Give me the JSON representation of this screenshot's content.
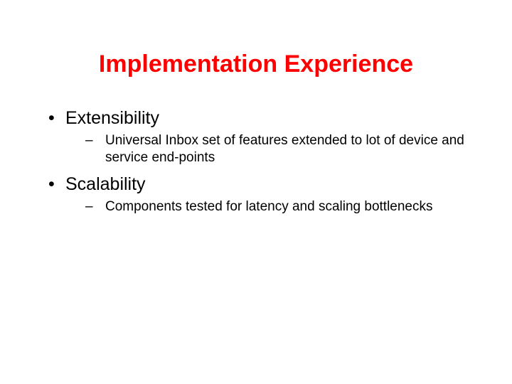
{
  "title": "Implementation Experience",
  "bullets": [
    {
      "text": "Extensibility",
      "sub": [
        "Universal Inbox set of features extended to lot of device and service end-points"
      ]
    },
    {
      "text": "Scalability",
      "sub": [
        "Components tested for latency and scaling bottlenecks"
      ]
    }
  ]
}
